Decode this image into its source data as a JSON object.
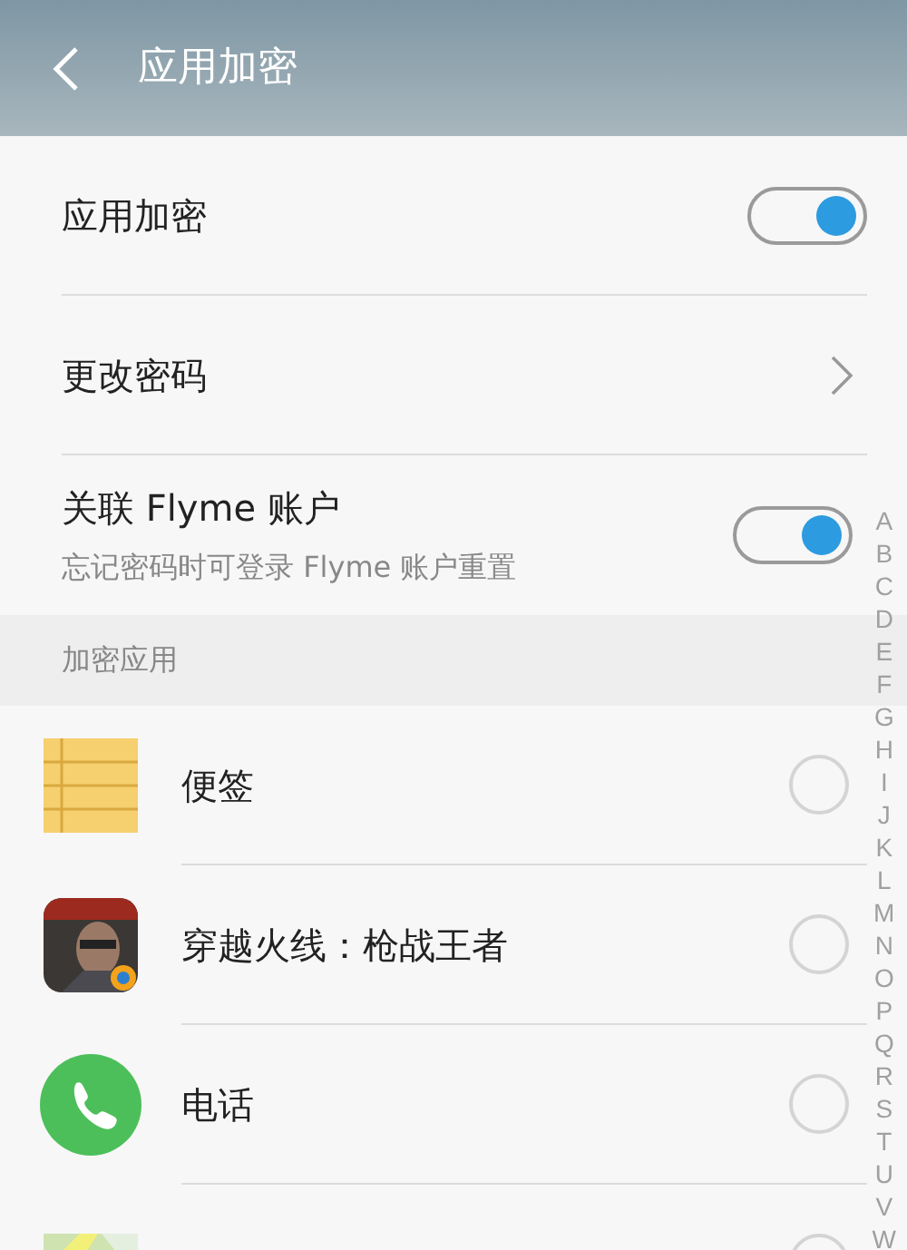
{
  "header": {
    "title": "应用加密"
  },
  "settings": [
    {
      "kind": "switch",
      "label": "应用加密",
      "on": true
    },
    {
      "kind": "link",
      "label": "更改密码"
    },
    {
      "kind": "switch",
      "label": "关联 Flyme 账户",
      "sublabel": "忘记密码时可登录 Flyme 账户重置",
      "on": true
    }
  ],
  "section": {
    "title": "加密应用"
  },
  "apps": [
    {
      "kind": "notes",
      "name": "便签",
      "checked": false
    },
    {
      "kind": "picture",
      "name": "穿越火线：枪战王者",
      "checked": false
    },
    {
      "kind": "phone",
      "name": "电话",
      "checked": false
    },
    {
      "kind": "map",
      "checked": false
    }
  ],
  "index": [
    "A",
    "B",
    "C",
    "D",
    "E",
    "F",
    "G",
    "H",
    "I",
    "J",
    "K",
    "L",
    "M",
    "N",
    "O",
    "P",
    "Q",
    "R",
    "S",
    "T",
    "U",
    "V",
    "W"
  ]
}
